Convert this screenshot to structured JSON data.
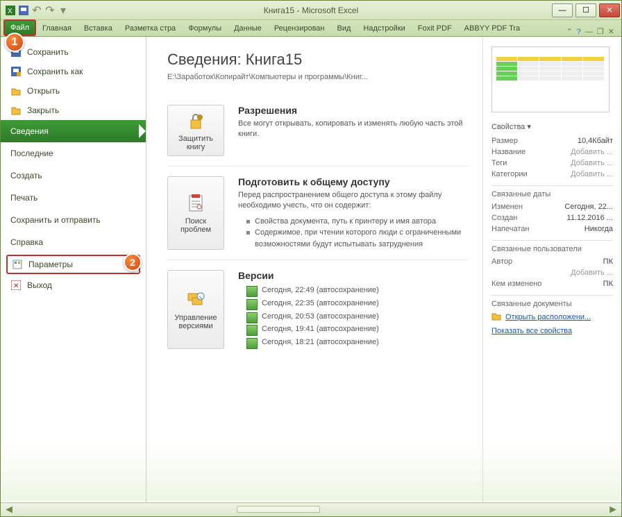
{
  "window_title": "Книга15  -  Microsoft Excel",
  "tabs": {
    "file": "Файл",
    "items": [
      "Главная",
      "Вставка",
      "Разметка стра",
      "Формулы",
      "Данные",
      "Рецензирован",
      "Вид",
      "Надстройки",
      "Foxit PDF",
      "ABBYY PDF Tra"
    ]
  },
  "nav": {
    "save": "Сохранить",
    "saveas": "Сохранить как",
    "open": "Открыть",
    "close": "Закрыть",
    "info": "Сведения",
    "recent": "Последние",
    "new": "Создать",
    "print": "Печать",
    "share": "Сохранить и отправить",
    "help": "Справка",
    "options": "Параметры",
    "exit": "Выход"
  },
  "info": {
    "title_prefix": "Сведения: ",
    "title_doc": "Книга15",
    "path": "E:\\Заработок\\Копирайт\\Компьютеры и программы\\Книг...",
    "protect_btn": "Защитить книгу",
    "protect_h": "Разрешения",
    "protect_p": "Все могут открывать, копировать и изменять любую часть этой книги.",
    "inspect_btn": "Поиск проблем",
    "inspect_h": "Подготовить к общему доступу",
    "inspect_p": "Перед распространением общего доступа к этому файлу необходимо учесть, что он содержит:",
    "inspect_li1": "Свойства документа, путь к принтеру и имя автора",
    "inspect_li2": "Содержимое, при чтении которого люди с ограниченными возможностями будут испытывать затруднения",
    "versions_btn": "Управление версиями",
    "versions_h": "Версии",
    "versions": [
      "Сегодня, 22:49 (автосохранение)",
      "Сегодня, 22:35 (автосохранение)",
      "Сегодня, 20:53 (автосохранение)",
      "Сегодня, 19:41 (автосохранение)",
      "Сегодня, 18:21 (автосохранение)"
    ]
  },
  "props": {
    "header": "Свойства",
    "size_k": "Размер",
    "size_v": "10,4Кбайт",
    "title_k": "Название",
    "title_v": "Добавить ...",
    "tags_k": "Теги",
    "tags_v": "Добавить ...",
    "cat_k": "Категории",
    "cat_v": "Добавить ...",
    "dates_h": "Связанные даты",
    "mod_k": "Изменен",
    "mod_v": "Сегодня, 22...",
    "created_k": "Создан",
    "created_v": "11.12.2016 ...",
    "printed_k": "Напечатан",
    "printed_v": "Никогда",
    "users_h": "Связанные пользователи",
    "author_k": "Автор",
    "author_v": "ПК",
    "author_add": "Добавить ...",
    "modby_k": "Кем изменено",
    "modby_v": "ПК",
    "docs_h": "Связанные документы",
    "open_loc": "Открыть расположени...",
    "show_all": "Показать все свойства"
  }
}
